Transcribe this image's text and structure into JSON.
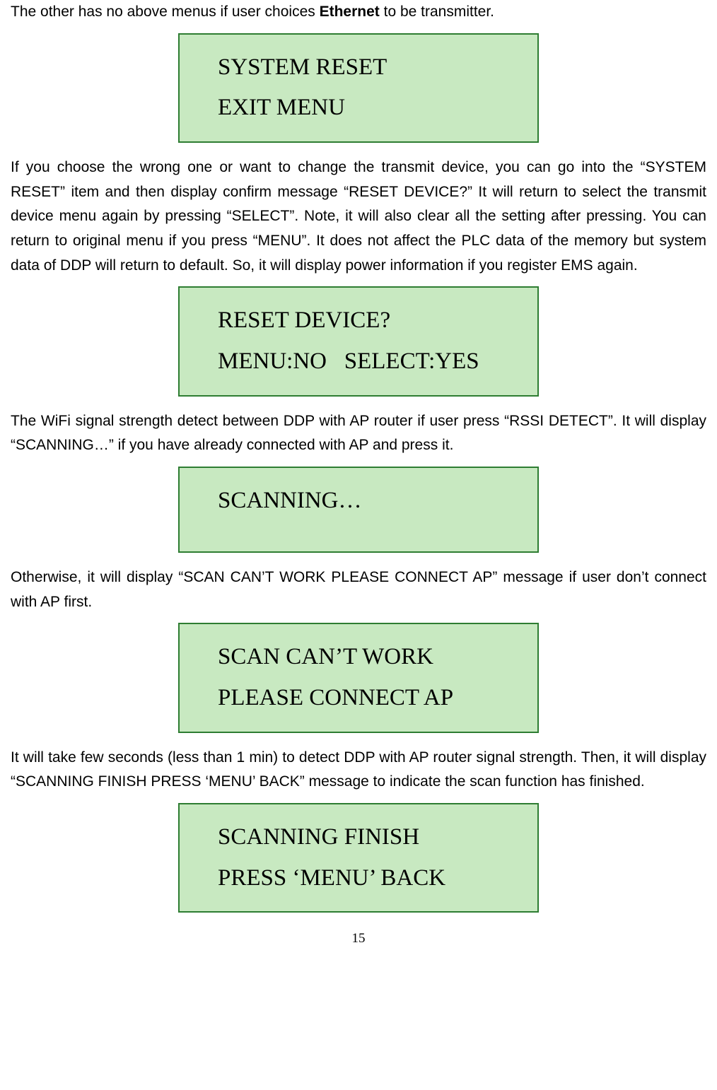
{
  "intro_text_prefix": "The other has no above menus if user choices ",
  "intro_text_bold": "Ethernet",
  "intro_text_suffix": " to be transmitter.",
  "box1": {
    "line1": "SYSTEM RESET",
    "line2": "EXIT MENU"
  },
  "para2": "If you choose the wrong one or want to change the transmit device, you can go into the “SYSTEM RESET” item and then display confirm message “RESET DEVICE?” It will return to select the transmit device menu again by pressing “SELECT”. Note, it will also clear all the setting after pressing. You can return to original menu if you press “MENU”. It does not affect the PLC data of the memory but system data of DDP will return to default. So, it will display power information if you register EMS again.",
  "box2": {
    "line1": "RESET DEVICE?",
    "line2": "MENU:NO   SELECT:YES"
  },
  "para3": "The WiFi signal strength detect between DDP with AP router if user press “RSSI DETECT”. It will display “SCANNING…” if you have already connected with AP and press it.",
  "box3": {
    "line1": "SCANNING…"
  },
  "para4": "Otherwise, it will display “SCAN CAN’T WORK PLEASE CONNECT AP” message if user don’t connect with AP first.",
  "box4": {
    "line1": "SCAN CAN’T WORK",
    "line2": "PLEASE CONNECT AP"
  },
  "para5": "It will take few seconds (less than 1 min) to detect DDP with AP router signal strength. Then, it will display “SCANNING FINISH PRESS ‘MENU’ BACK” message to indicate the scan function has finished.",
  "box5": {
    "line1": "SCANNING FINISH",
    "line2": "PRESS ‘MENU’ BACK"
  },
  "page_number": "15"
}
